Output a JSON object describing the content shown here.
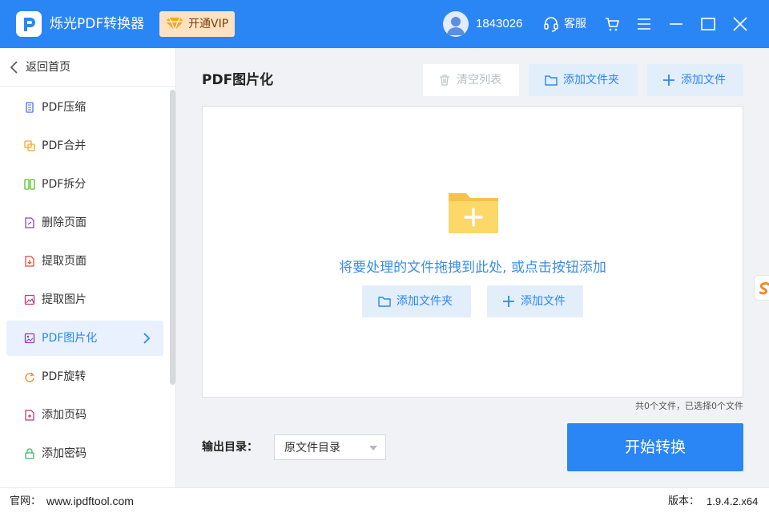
{
  "app": {
    "name": "烁光PDF转换器",
    "vip_label": "开通VIP"
  },
  "user": {
    "id": "1843026"
  },
  "header": {
    "service_label": "客服"
  },
  "sidebar": {
    "back_label": "返回首页",
    "items": [
      {
        "label": "PDF压缩",
        "icon": "compress-icon",
        "color": "#4a6cf7"
      },
      {
        "label": "PDF合并",
        "icon": "merge-icon",
        "color": "#f5a623"
      },
      {
        "label": "PDF拆分",
        "icon": "split-icon",
        "color": "#52c41a"
      },
      {
        "label": "删除页面",
        "icon": "delete-page-icon",
        "color": "#8e44ad"
      },
      {
        "label": "提取页面",
        "icon": "extract-page-icon",
        "color": "#e74c3c"
      },
      {
        "label": "提取图片",
        "icon": "extract-image-icon",
        "color": "#c0397a"
      },
      {
        "label": "PDF图片化",
        "icon": "pdf-to-image-icon",
        "color": "#8e44ad",
        "active": true
      },
      {
        "label": "PDF旋转",
        "icon": "rotate-icon",
        "color": "#f08c2e"
      },
      {
        "label": "添加页码",
        "icon": "page-number-icon",
        "color": "#c0397a"
      },
      {
        "label": "添加密码",
        "icon": "lock-icon",
        "color": "#3cb371"
      }
    ]
  },
  "main": {
    "title": "PDF图片化",
    "clear_label": "清空列表",
    "add_folder_label": "添加文件夹",
    "add_file_label": "添加文件",
    "drop_hint": "将要处理的文件拖拽到此处, 或点击按钮添加",
    "count_text": "共0个文件，已选择0个文件",
    "output_label": "输出目录：",
    "output_value": "原文件目录",
    "start_label": "开始转换"
  },
  "status": {
    "site_label": "官网：",
    "site_url": "www.ipdftool.com",
    "version_label": "版本：",
    "version_value": "1.9.4.2.x64"
  },
  "colors": {
    "accent": "#2b86f5",
    "button_light": "#e3eefb",
    "vip_bg": "#fde2c2"
  }
}
